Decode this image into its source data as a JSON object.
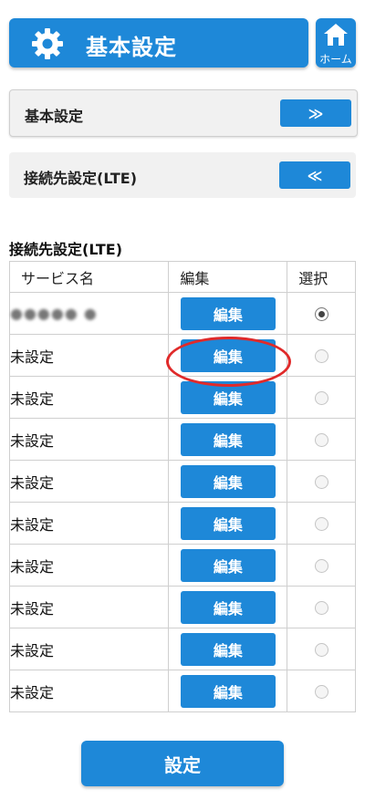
{
  "header": {
    "title": "基本設定",
    "home_label": "ホーム"
  },
  "sections": [
    {
      "label": "基本設定",
      "button_label": "≫"
    },
    {
      "label": "接続先設定(LTE)",
      "button_label": "≪"
    }
  ],
  "table": {
    "title": "接続先設定(LTE)",
    "columns": [
      "サービス名",
      "編集",
      "選択"
    ],
    "rows": [
      {
        "name": "●●●●● ●",
        "edit_label": "編集",
        "selected": true
      },
      {
        "name": "未設定",
        "edit_label": "編集",
        "selected": false
      },
      {
        "name": "未設定",
        "edit_label": "編集",
        "selected": false
      },
      {
        "name": "未設定",
        "edit_label": "編集",
        "selected": false
      },
      {
        "name": "未設定",
        "edit_label": "編集",
        "selected": false
      },
      {
        "name": "未設定",
        "edit_label": "編集",
        "selected": false
      },
      {
        "name": "未設定",
        "edit_label": "編集",
        "selected": false
      },
      {
        "name": "未設定",
        "edit_label": "編集",
        "selected": false
      },
      {
        "name": "未設定",
        "edit_label": "編集",
        "selected": false
      },
      {
        "name": "未設定",
        "edit_label": "編集",
        "selected": false
      }
    ]
  },
  "submit_label": "設定",
  "colors": {
    "accent": "#1e88d8",
    "highlight": "#e02a2a",
    "panel": "#f1f1f1"
  },
  "icons": {
    "header": "gear-icon",
    "home": "home-icon"
  }
}
